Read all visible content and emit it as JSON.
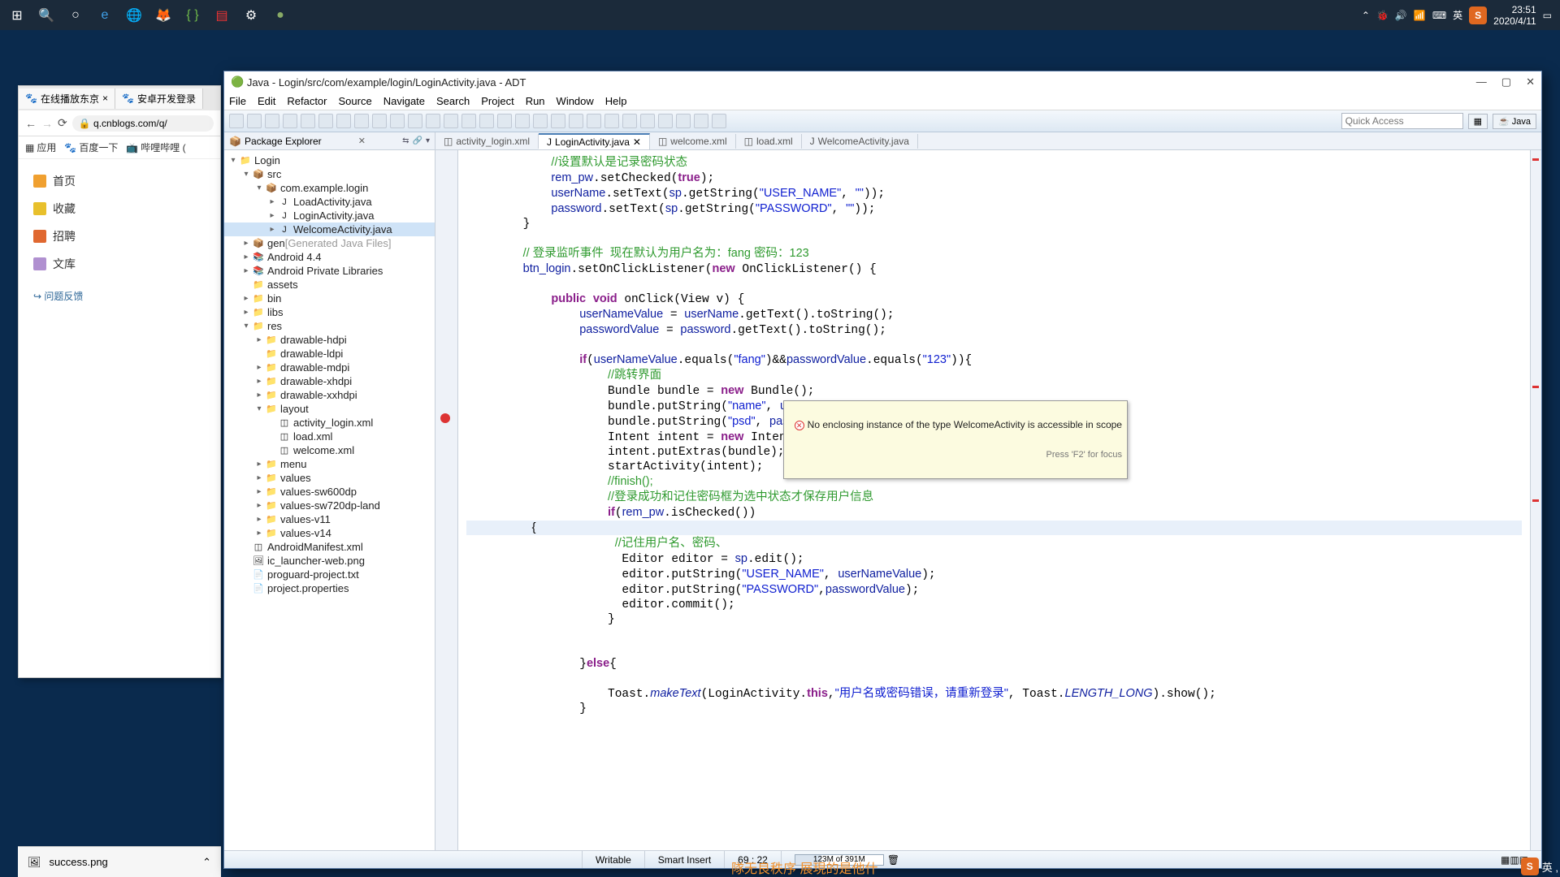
{
  "taskbar": {
    "clock_time": "23:51",
    "clock_date": "2020/4/11",
    "ime_lang": "英",
    "ime_s": "S"
  },
  "browser": {
    "tab1": "在线播放东京",
    "tab2": "安卓开发登录",
    "url": "q.cnblogs.com/q/",
    "bm_apps": "应用",
    "bm_baidu": "百度一下",
    "bm_bili": "哔哩哔哩 (",
    "side_home": "首页",
    "side_fav": "收藏",
    "side_recruit": "招聘",
    "side_lib": "文库",
    "feedback": "问题反馈"
  },
  "adt": {
    "title": "Java - Login/src/com/example/login/LoginActivity.java - ADT",
    "menu": [
      "File",
      "Edit",
      "Refactor",
      "Source",
      "Navigate",
      "Search",
      "Project",
      "Run",
      "Window",
      "Help"
    ],
    "quick_access_placeholder": "Quick Access",
    "perspective": "Java",
    "pkg_explorer_title": "Package Explorer",
    "tree": {
      "project": "Login",
      "src": "src",
      "pkg": "com.example.login",
      "f_load": "LoadActivity.java",
      "f_login": "LoginActivity.java",
      "f_welcome": "WelcomeActivity.java",
      "gen": "gen",
      "gen_note": "[Generated Java Files]",
      "android44": "Android 4.4",
      "apl": "Android Private Libraries",
      "assets": "assets",
      "bin": "bin",
      "libs": "libs",
      "res": "res",
      "d_hdpi": "drawable-hdpi",
      "d_ldpi": "drawable-ldpi",
      "d_mdpi": "drawable-mdpi",
      "d_xhdpi": "drawable-xhdpi",
      "d_xxhdpi": "drawable-xxhdpi",
      "layout": "layout",
      "l_activity_login": "activity_login.xml",
      "l_load": "load.xml",
      "l_welcome": "welcome.xml",
      "menu": "menu",
      "values": "values",
      "values600": "values-sw600dp",
      "values720": "values-sw720dp-land",
      "values11": "values-v11",
      "values14": "values-v14",
      "manifest": "AndroidManifest.xml",
      "ic_launcher": "ic_launcher-web.png",
      "proguard": "proguard-project.txt",
      "projprops": "project.properties"
    },
    "editor_tabs": {
      "t1": "activity_login.xml",
      "t2": "LoginActivity.java",
      "t3": "welcome.xml",
      "t4": "load.xml",
      "t5": "WelcomeActivity.java"
    },
    "tooltip": {
      "msg": "No enclosing instance of the type WelcomeActivity is accessible in scope",
      "hint": "Press 'F2' for focus"
    },
    "status": {
      "writable": "Writable",
      "insert": "Smart Insert",
      "pos": "69 : 22",
      "mem": "123M of 391M"
    }
  },
  "download": {
    "filename": "success.png"
  },
  "ime_bottom": {
    "s": "S",
    "lang": "英 ,"
  },
  "orange_strip": "隊无良秩序  展現的是他什"
}
